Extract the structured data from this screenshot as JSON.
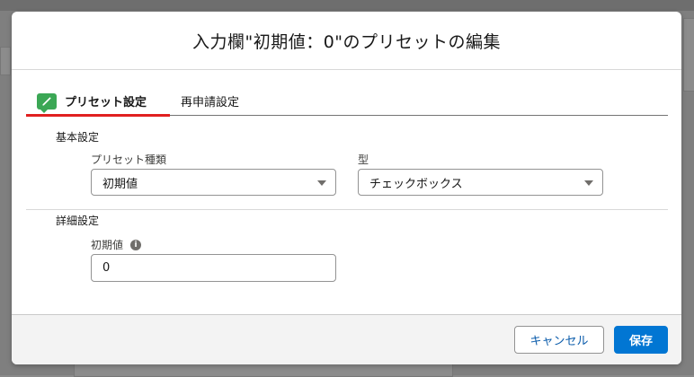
{
  "modal": {
    "title": "入力欄\"初期値：0\"のプリセットの編集",
    "close_icon": "close-icon"
  },
  "tabs": [
    {
      "label": "プリセット設定",
      "icon": "pencil-icon",
      "active": true
    },
    {
      "label": "再申請設定",
      "active": false
    }
  ],
  "basic_section": {
    "title": "基本設定",
    "preset_type": {
      "label": "プリセット種類",
      "value": "初期値"
    },
    "type": {
      "label": "型",
      "value": "チェックボックス"
    }
  },
  "detail_section": {
    "title": "詳細設定",
    "initial_value": {
      "label": "初期値",
      "info_icon": "info-icon",
      "value": "0"
    }
  },
  "footer": {
    "cancel_label": "キャンセル",
    "save_label": "保存"
  },
  "colors": {
    "brand": "#0176d3",
    "tab_active_underline": "#e02020",
    "tab_icon": "#3ba755"
  }
}
